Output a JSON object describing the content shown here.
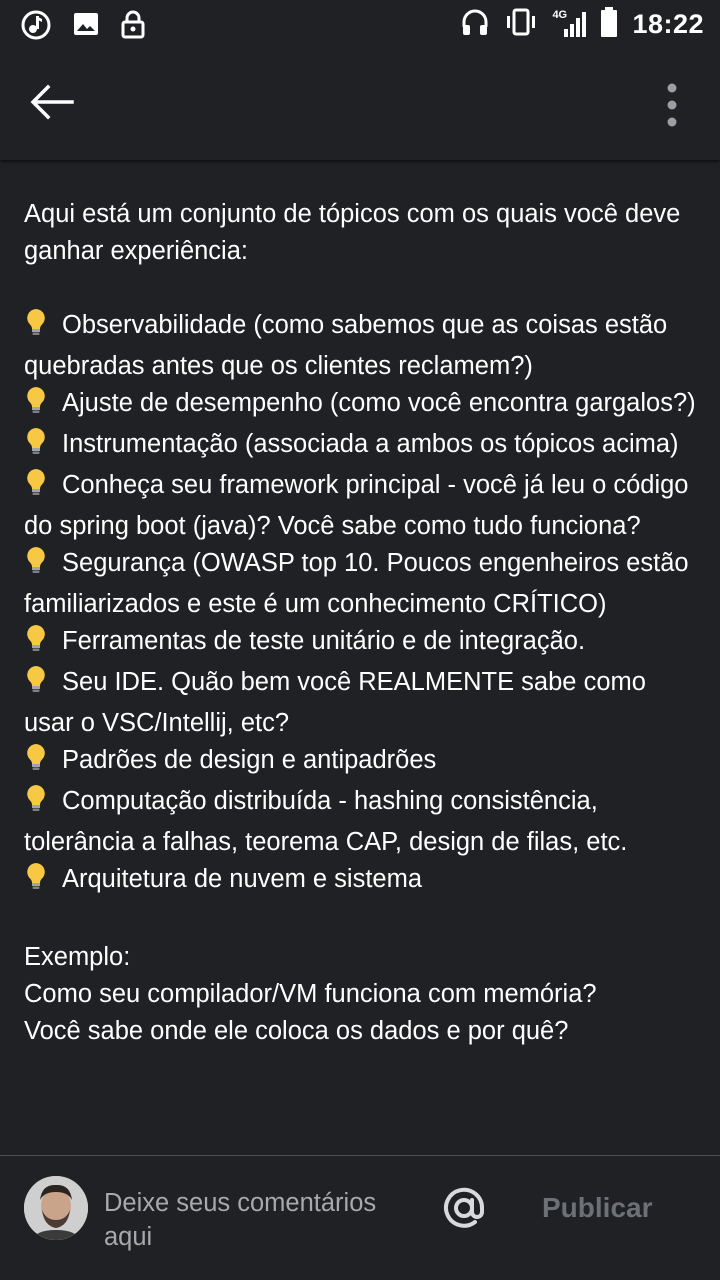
{
  "status_bar": {
    "time": "18:22",
    "network": "4G",
    "icons": [
      "music-sync-icon",
      "image-icon",
      "lock-icon",
      "headphones-icon",
      "vibrate-icon",
      "signal-icon",
      "battery-icon"
    ]
  },
  "app_bar": {
    "back_icon": "arrow-left-icon",
    "more_icon": "more-vertical-icon"
  },
  "post": {
    "intro": "Aqui está um conjunto de tópicos com os quais você deve ganhar experiência:",
    "topics": [
      "Observabilidade (como sabemos que as coisas estão quebradas antes que os clientes reclamem?)",
      "Ajuste de desempenho (como você encontra gargalos?)",
      "Instrumentação (associada a ambos os tópicos acima)",
      "Conheça seu framework principal - você já leu o código do spring boot (java)? Você sabe como tudo funciona?",
      "Segurança (OWASP top 10. Poucos engenheiros estão familiarizados e este é um conhecimento CRÍTICO)",
      "Ferramentas de teste unitário e de integração.",
      "Seu IDE. Quão bem você REALMENTE sabe como usar o VSC/Intellij, etc?",
      "Padrões de design e antipadrões",
      "Computação distribuída - hashing consistência, tolerância a falhas, teorema CAP, design de filas, etc.",
      "Arquitetura de nuvem e sistema"
    ],
    "example_label": "Exemplo:",
    "example_line1": "Como seu compilador/VM funciona com memória?",
    "example_line2": "Você sabe onde ele coloca os dados e por quê?"
  },
  "comment_bar": {
    "placeholder": "Deixe seus comentários aqui",
    "mention_icon": "at-sign-icon",
    "publish_label": "Publicar"
  },
  "colors": {
    "background": "#1f2125",
    "text": "#ffffff",
    "placeholder": "#a7a9ad",
    "publish_disabled": "#6d7075",
    "bulb": "#f7c843"
  }
}
